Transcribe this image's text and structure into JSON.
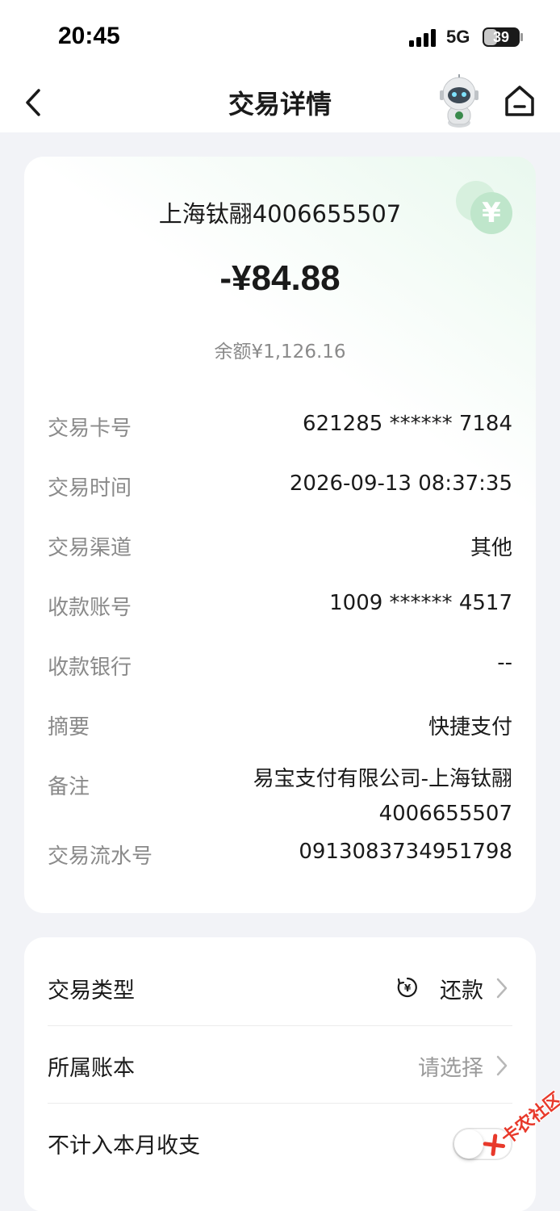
{
  "status_bar": {
    "time": "20:45",
    "network": "5G",
    "battery": "39",
    "battery_level": 0.39
  },
  "nav": {
    "title": "交易详情",
    "back_icon": "chevron-left-icon",
    "assistant_icon": "robot-assistant-icon",
    "home_icon": "home-icon"
  },
  "transaction": {
    "merchant": "上海钛翮4006655507",
    "amount": "-¥84.88",
    "balance": "余额¥1,126.16",
    "currency_badge": "¥",
    "details": [
      {
        "label": "交易卡号",
        "value": "621285 ****** 7184"
      },
      {
        "label": "交易时间",
        "value": "2026-09-13 08:37:35"
      },
      {
        "label": "交易渠道",
        "value": "其他"
      },
      {
        "label": "收款账号",
        "value": "1009 ****** 4517"
      },
      {
        "label": "收款银行",
        "value": "--"
      },
      {
        "label": "摘要",
        "value": "快捷支付"
      },
      {
        "label": "备注",
        "value": "易宝支付有限公司-上海钛翮4006655507"
      },
      {
        "label": "交易流水号",
        "value": "0913083734951798"
      }
    ]
  },
  "settings": {
    "type_label": "交易类型",
    "type_value": "还款",
    "book_label": "所属账本",
    "book_value": "请选择",
    "exclude_label": "不计入本月收支",
    "exclude_on": false
  },
  "watermark": {
    "text": "卡农社区"
  },
  "colors": {
    "accent_green": "#bfe6cb",
    "watermark_red": "#e8392b"
  }
}
